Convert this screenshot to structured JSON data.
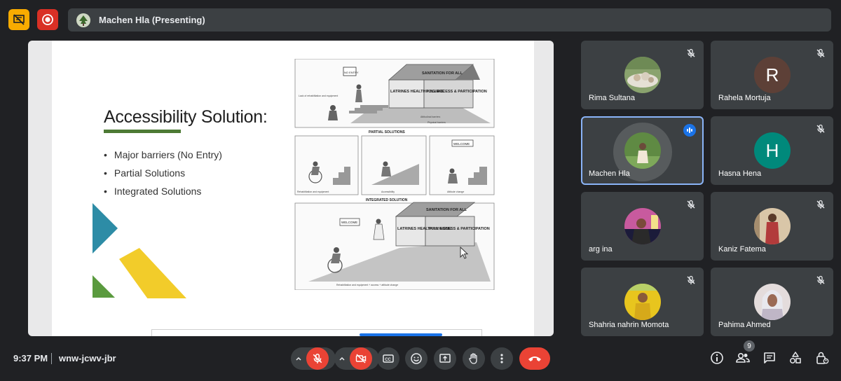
{
  "header": {
    "presenter_label": "Machen Hla (Presenting)",
    "icons": [
      "presentation-off-icon",
      "record-icon"
    ]
  },
  "slide": {
    "title": "Accessibility Solution:",
    "bullets": [
      "Major barriers (No Entry)",
      "Partial Solutions",
      "Integrated Solutions"
    ],
    "diagram": {
      "top_sign": "NO ENTRY",
      "top_house_roof": "SANITATION FOR ALL",
      "top_house_left": "LATRINES HEALTH HYGIENE",
      "top_house_right": "FULL ACCESS & PARTICIPATION",
      "top_note_1": "Lack of rehabilitation and equipment",
      "top_note_2": "Attitudinal barriers",
      "top_note_3": "Physical barriers",
      "partial_title": "PARTIAL SOLUTIONS",
      "partial_captions": [
        "Rehabilitation and equipment",
        "Accessibility",
        "Attitude change"
      ],
      "partial_sign": "WELCOME",
      "integrated_title": "INTEGRATED SOLUTION",
      "integrated_sign": "WELCOME",
      "integrated_roof": "SANITATION FOR ALL",
      "integrated_left": "LATRINES HEALTH HYGIENE",
      "integrated_right": "FULL ACCESS & PARTICIPATION",
      "integrated_caption": "Rehabilitation and equipment + access + attitude change"
    }
  },
  "participants": [
    {
      "name": "Rima Sultana",
      "muted": true,
      "avatar": "photo",
      "color": "#b8c9b0"
    },
    {
      "name": "Rahela Mortuja",
      "muted": true,
      "avatar": "letter",
      "letter": "R",
      "color": "#5d4037"
    },
    {
      "name": "Machen Hla",
      "muted": false,
      "speaking": true,
      "avatar": "photo",
      "color": "#7a9a5a"
    },
    {
      "name": "Hasna Hena",
      "muted": true,
      "avatar": "letter",
      "letter": "H",
      "color": "#00897b"
    },
    {
      "name": "arg ina",
      "muted": true,
      "avatar": "photo",
      "color": "#9a3a8a"
    },
    {
      "name": "Kaniz Fatema",
      "muted": true,
      "avatar": "photo",
      "color": "#b7573f"
    },
    {
      "name": "Shahria nahrin Momota",
      "muted": true,
      "avatar": "photo",
      "color": "#e0b520"
    },
    {
      "name": "Pahima Ahmed",
      "muted": true,
      "avatar": "photo",
      "color": "#d9d0cf"
    }
  ],
  "bottombar": {
    "time": "9:37 PM",
    "meeting_code": "wnw-jcwv-jbr",
    "participant_count": "9",
    "controls": [
      "mic-off",
      "camera-off",
      "captions",
      "reactions",
      "present-screen",
      "raise-hand",
      "more-options",
      "leave-call"
    ],
    "right_controls": [
      "meeting-info",
      "people",
      "chat",
      "activities",
      "host-controls"
    ]
  }
}
